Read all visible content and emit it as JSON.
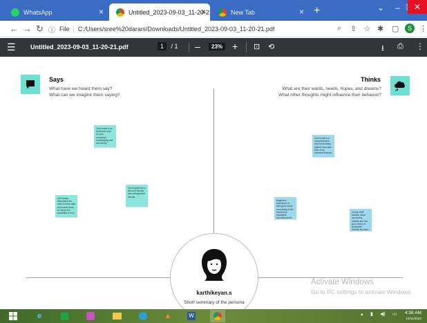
{
  "browser": {
    "tabs": [
      {
        "label": "WhatsApp",
        "active": false,
        "icon": "whatsapp-icon"
      },
      {
        "label": "Untitled_2023-09-03_11-20-21.p",
        "active": true,
        "icon": "chrome-icon"
      },
      {
        "label": "New Tab",
        "active": false,
        "icon": "chrome-icon"
      }
    ],
    "new_tab_glyph": "+",
    "address": {
      "prefix": "File",
      "path": "C:/Users/sree%20darani/Downloads/Untitled_2023-09-03_11-20-21.pdf"
    },
    "profile_initial": "S"
  },
  "pdf_toolbar": {
    "filename": "Untitled_2023-09-03_11-20-21.pdf",
    "page_current": "1",
    "page_total": "/ 1",
    "zoom": "23%"
  },
  "empathy_map": {
    "says": {
      "title": "Says",
      "line1": "What have we heard them say?",
      "line2": "What can we imagine them saying?"
    },
    "thinks": {
      "title": "Thinks",
      "line1": "What are their wants, needs, hopes, and dreams?",
      "line2": "What other thoughts might influence their behavior?"
    },
    "stickies": {
      "s1": "Ochi lender is an freelancer work for your company's bookkeeping and accounting",
      "s2": "Ochi library information the need to enter data from travel forms to reduce the possibility of error",
      "s3": "Ochi experience a less and friendly and management friendly",
      "s4": "Ochi lender is a comprehensive cloud accounting platform that data both of my business finances",
      "s5": "Beginners experience of having the same accounting of the books thus reportable, according sheet and data and prepare invoices",
      "s6": "Certain KMF function about accounting mobility and has go to clerks of accessible mobility the basic administrative tools"
    },
    "persona": {
      "name": "karthikeyan.s",
      "subtitle": "Short summary of the persona"
    }
  },
  "watermark": {
    "line1": "Activate Windows",
    "line2": "Go to PC settings to activate Windows."
  },
  "taskbar": {
    "time": "4:38 AM",
    "date": "10/31/2023"
  },
  "colors": {
    "tab_strip": "#3b6cc4",
    "pdf_toolbar": "#323639",
    "sticky_teal": "#8de6dd",
    "sticky_blue": "#9dd9ee",
    "quadrant_icon": "#6de0d2"
  }
}
